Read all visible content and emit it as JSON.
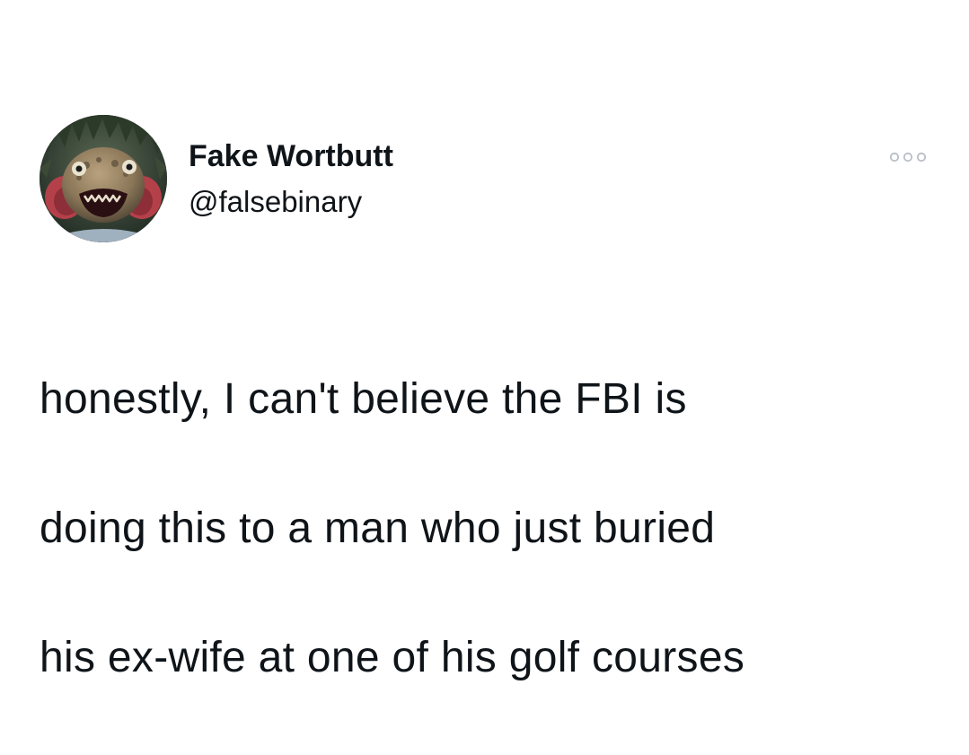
{
  "tweet": {
    "author": {
      "display_name": "Fake Wortbutt",
      "handle": "@falsebinary",
      "avatar_icon": "creature-avatar"
    },
    "more_icon": "more-options-icon",
    "text_lines": [
      "honestly, I can't believe the FBI is",
      "doing this to a man who just buried",
      "his ex-wife at one of his golf courses"
    ]
  },
  "colors": {
    "background": "#ffffff",
    "text": "#0f1419",
    "more_dots": "#b8bfc6"
  }
}
